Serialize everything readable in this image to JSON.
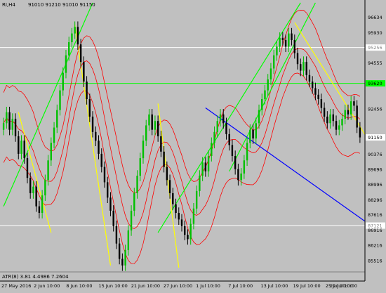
{
  "header": {
    "symbol_timeframe": "RI,H4",
    "ohlc": "91010 91210 91010 91150"
  },
  "indicator_label": "ATR(8) 3.81 4.4986 7.2604",
  "price_labels": [
    "96634",
    "95930",
    "95256",
    "94555",
    "93620",
    "92456",
    "91150",
    "90376",
    "89696",
    "88996",
    "88296",
    "87616",
    "87121",
    "86916",
    "86216",
    "85516"
  ],
  "price_badges": {
    "white_line_upper": "95256",
    "green_line": "93620",
    "current_price": "91150",
    "white_line_lower": "87121"
  },
  "time_labels": [
    "27 May 2016",
    "2 Jun 10:00",
    "8 Jun 10:00",
    "15 Jun 10:00",
    "21 Jun 10:00",
    "27 Jun 10:00",
    "1 Jul 10:00",
    "7 Jul 10:00",
    "13 Jul 10:00",
    "19 Jul 10:00",
    "25 Jul 10:00",
    "29 Jul 10:00"
  ],
  "colors": {
    "background": "#c0c0c0",
    "bull_candle": "#00c000",
    "bear_candle": "#000000",
    "trend_green": "#00ff00",
    "trend_yellow": "#ffff00",
    "trend_blue": "#0000ff",
    "bands_red": "#ff0000",
    "hline_white": "#ffffff",
    "hline_green": "#00ff00",
    "current_badge": "#ffffff"
  },
  "chart_data": {
    "type": "candlestick",
    "symbol": "RI",
    "timeframe": "H4",
    "current_price": 91150,
    "y_range": [
      85100,
      97300
    ],
    "x_ticks": [
      "27 May 2016",
      "2 Jun 10:00",
      "8 Jun 10:00",
      "15 Jun 10:00",
      "21 Jun 10:00",
      "27 Jun 10:00",
      "1 Jul 10:00",
      "7 Jul 10:00",
      "13 Jul 10:00",
      "19 Jul 10:00",
      "25 Jul 10:00",
      "29 Jul 10:00"
    ],
    "horizontal_levels": [
      {
        "value": 95256,
        "color": "white"
      },
      {
        "value": 93620,
        "color": "green"
      },
      {
        "value": 87121,
        "color": "white"
      }
    ],
    "closes": [
      91800,
      92300,
      91500,
      92000,
      91200,
      90400,
      91000,
      90200,
      89300,
      88600,
      88900,
      88000,
      87700,
      88500,
      89200,
      90100,
      90900,
      91600,
      92400,
      93300,
      94100,
      94900,
      95500,
      95900,
      96200,
      95400,
      94600,
      93700,
      92900,
      92100,
      91400,
      91000,
      90400,
      89800,
      89100,
      88400,
      87800,
      87100,
      86300,
      85600,
      85300,
      86000,
      86900,
      87800,
      88600,
      89400,
      90200,
      91000,
      91700,
      92200,
      91500,
      91900,
      91200,
      90500,
      89800,
      89200,
      88600,
      88100,
      87700,
      87400,
      87100,
      86700,
      86500,
      87200,
      87900,
      88700,
      89400,
      90000,
      89600,
      90300,
      90900,
      91400,
      91900,
      92200,
      91800,
      91300,
      90800,
      90300,
      89700,
      89200,
      89500,
      90100,
      90900,
      91500,
      91100,
      91800,
      92400,
      92900,
      93300,
      93800,
      94300,
      94900,
      95300,
      95700,
      95600,
      95300,
      95900,
      95600,
      95000,
      94500,
      94200,
      94600,
      94000,
      93700,
      93400,
      93100,
      92900,
      92500,
      92100,
      91800,
      92200,
      91900,
      91500,
      91700,
      92000,
      92400,
      92200,
      92800,
      92600,
      91600,
      91150
    ]
  }
}
